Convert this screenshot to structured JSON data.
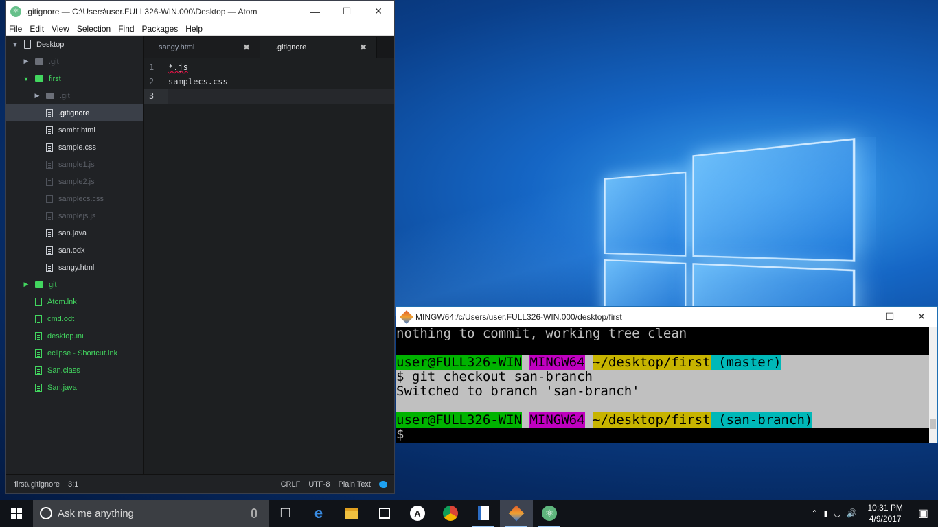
{
  "atom": {
    "title": ".gitignore — C:\\Users\\user.FULL326-WIN.000\\Desktop — Atom",
    "menu": [
      "File",
      "Edit",
      "View",
      "Selection",
      "Find",
      "Packages",
      "Help"
    ],
    "tree": [
      {
        "label": "Desktop",
        "indent": 0,
        "arrow": "▼",
        "icon": "repo",
        "style": "normal"
      },
      {
        "label": ".git",
        "indent": 1,
        "arrow": "▶",
        "icon": "folder",
        "style": "dim"
      },
      {
        "label": "first",
        "indent": 1,
        "arrow": "▼",
        "icon": "folder-green",
        "style": "green"
      },
      {
        "label": ".git",
        "indent": 2,
        "arrow": "▶",
        "icon": "folder",
        "style": "dim"
      },
      {
        "label": ".gitignore",
        "indent": 2,
        "arrow": "",
        "icon": "file",
        "style": "selected"
      },
      {
        "label": "samht.html",
        "indent": 2,
        "arrow": "",
        "icon": "file",
        "style": "normal"
      },
      {
        "label": "sample.css",
        "indent": 2,
        "arrow": "",
        "icon": "file",
        "style": "normal"
      },
      {
        "label": "sample1.js",
        "indent": 2,
        "arrow": "",
        "icon": "file-dim",
        "style": "dim"
      },
      {
        "label": "sample2.js",
        "indent": 2,
        "arrow": "",
        "icon": "file-dim",
        "style": "dim"
      },
      {
        "label": "samplecs.css",
        "indent": 2,
        "arrow": "",
        "icon": "file-dim",
        "style": "dim"
      },
      {
        "label": "samplejs.js",
        "indent": 2,
        "arrow": "",
        "icon": "file-dim",
        "style": "dim"
      },
      {
        "label": "san.java",
        "indent": 2,
        "arrow": "",
        "icon": "file",
        "style": "normal"
      },
      {
        "label": "san.odx",
        "indent": 2,
        "arrow": "",
        "icon": "file",
        "style": "normal"
      },
      {
        "label": "sangy.html",
        "indent": 2,
        "arrow": "",
        "icon": "file",
        "style": "normal"
      },
      {
        "label": "git",
        "indent": 1,
        "arrow": "▶",
        "icon": "folder-green",
        "style": "green"
      },
      {
        "label": "Atom.lnk",
        "indent": 1,
        "arrow": "",
        "icon": "file-green",
        "style": "green"
      },
      {
        "label": "cmd.odt",
        "indent": 1,
        "arrow": "",
        "icon": "file-green",
        "style": "green"
      },
      {
        "label": "desktop.ini",
        "indent": 1,
        "arrow": "",
        "icon": "file-green",
        "style": "green"
      },
      {
        "label": "eclipse - Shortcut.lnk",
        "indent": 1,
        "arrow": "",
        "icon": "file-green",
        "style": "green"
      },
      {
        "label": "San.class",
        "indent": 1,
        "arrow": "",
        "icon": "file-green",
        "style": "green"
      },
      {
        "label": "San.java",
        "indent": 1,
        "arrow": "",
        "icon": "file-green",
        "style": "green"
      }
    ],
    "tabs": [
      {
        "label": "sangy.html",
        "active": false
      },
      {
        "label": ".gitignore",
        "active": true
      }
    ],
    "close_glyph": "✖",
    "lines": [
      "*.js",
      "samplecs.css",
      ""
    ],
    "line_numbers": [
      "1",
      "2",
      "3"
    ],
    "status": {
      "path": "first\\.gitignore",
      "cursor": "3:1",
      "line_ending": "CRLF",
      "encoding": "UTF-8",
      "grammar": "Plain Text"
    }
  },
  "terminal": {
    "title": "MINGW64:/c/Users/user.FULL326-WIN.000/desktop/first",
    "lines": {
      "l1": "nothing to commit, working tree clean",
      "p1_user": "user@FULL326-WIN",
      "p1_sys": "MINGW64",
      "p1_path": "~/desktop/first",
      "p1_branch": " (master)",
      "cmd": "$ git checkout san-branch",
      "out": "Switched to branch 'san-branch'",
      "p2_user": "user@FULL326-WIN",
      "p2_sys": "MINGW64",
      "p2_path": "~/desktop/first",
      "p2_branch": " (san-branch)",
      "prompt": "$"
    }
  },
  "taskbar": {
    "search_placeholder": "Ask me anything",
    "apps": [
      "task-view",
      "edge",
      "file-explorer",
      "store",
      "app-a",
      "chrome",
      "wordpad",
      "git",
      "atom"
    ],
    "time": "10:31 PM",
    "date": "4/9/2017"
  }
}
